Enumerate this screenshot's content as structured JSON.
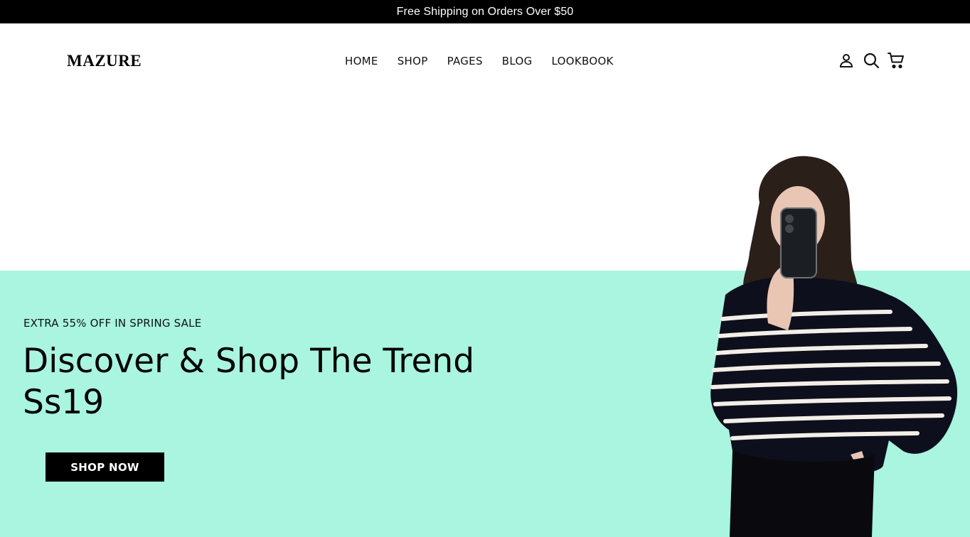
{
  "announcement": {
    "text": "Free Shipping on Orders Over $50"
  },
  "header": {
    "logo": "MAZURE",
    "nav": [
      {
        "label": "HOME"
      },
      {
        "label": "SHOP"
      },
      {
        "label": "PAGES"
      },
      {
        "label": "BLOG"
      },
      {
        "label": "LOOKBOOK"
      }
    ],
    "icons": [
      "user-icon",
      "search-icon",
      "cart-icon"
    ]
  },
  "hero": {
    "subtitle": "EXTRA 55% OFF IN SPRING SALE",
    "title": "Discover & Shop The Trend Ss19",
    "cta_label": "SHOP NOW",
    "image": "model-photo",
    "background_color": "#a9f5df"
  },
  "colors": {
    "topbar": "#000000",
    "button": "#000000",
    "hero": "#a9f5df"
  }
}
